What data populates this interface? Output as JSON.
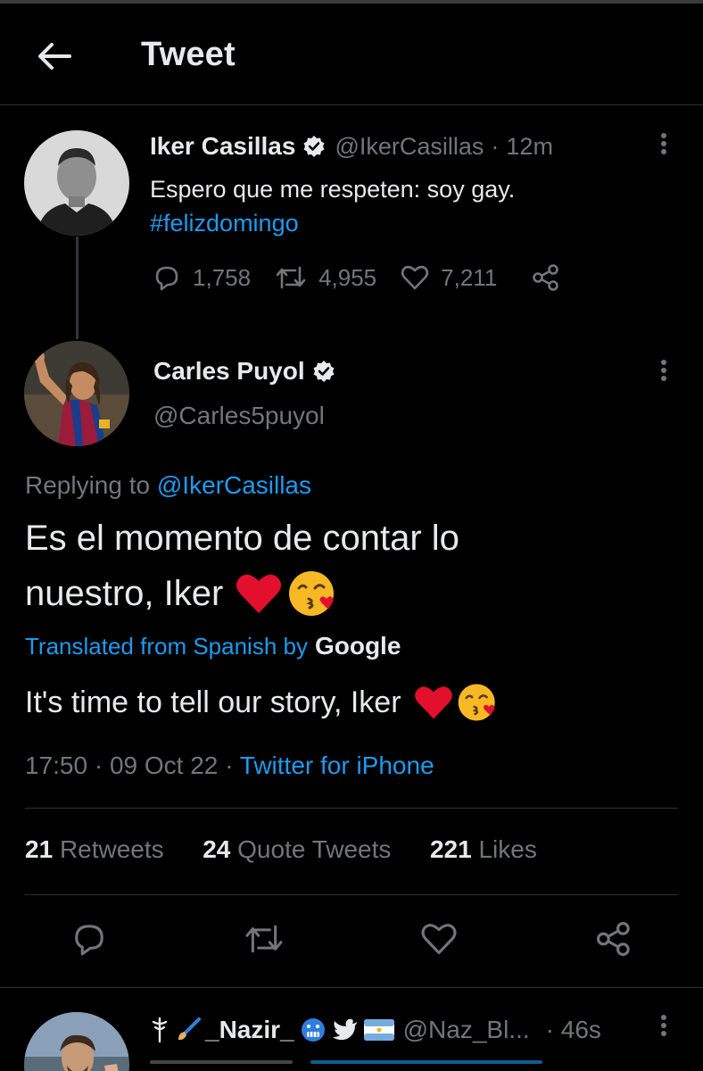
{
  "header": {
    "title": "Tweet",
    "back_icon": "arrow-left-icon"
  },
  "parent_tweet": {
    "display_name": "Iker Casillas",
    "handle": "@IkerCasillas",
    "separator": "·",
    "time_ago": "12m",
    "text": "Espero que me respeten: soy gay.",
    "hashtag": "#felizdomingo",
    "replies": "1,758",
    "retweets": "4,955",
    "likes": "7,211"
  },
  "reply_tweet": {
    "display_name": "Carles Puyol",
    "handle": "@Carles5puyol",
    "replying_prefix": "Replying to",
    "replying_handle": "@IkerCasillas",
    "text_line1": "Es el momento de contar lo",
    "text_line2": "nuestro, Iker",
    "translated_label": "Translated from Spanish by",
    "translator": "Google",
    "translation": "It's time to tell our story, Iker",
    "time": "17:50",
    "date": "09 Oct 22",
    "source": "Twitter for iPhone",
    "separator": "·",
    "retweet_count": "21",
    "retweet_label": "Retweets",
    "quote_count": "24",
    "quote_label": "Quote Tweets",
    "like_count": "221",
    "like_label": "Likes"
  },
  "next_reply": {
    "display_name": "_Nazir_",
    "handle": "@Naz_Bl...",
    "time_ago": "· 46s"
  },
  "colors": {
    "accent": "#1d9bf0",
    "muted": "#71767b",
    "text": "#e7e9ea",
    "heart": "#e0245e"
  }
}
